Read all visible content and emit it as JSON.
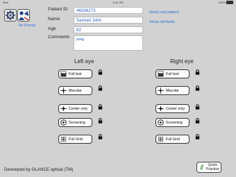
{
  "status_bar": {
    "carrier": "iPad",
    "time": "6:32 PM",
    "battery": "100%"
  },
  "side": {
    "no_prompt_label": "No Prompt"
  },
  "patient": {
    "id_label": "Patient ID",
    "id_value": "46336273",
    "name_label": "Name",
    "name_value": "Samuel John",
    "age_label": "Age",
    "age_value": "82",
    "comments_label": "Comments",
    "comments_value": "poag"
  },
  "links": {
    "new_load": "New/Load patient",
    "show_old": "Show old fields"
  },
  "left_eye": {
    "heading": "Left eye",
    "tests": [
      {
        "label": "Full test",
        "icon": "full-test-icon"
      },
      {
        "label": "Macular",
        "icon": "macular-icon"
      },
      {
        "label": "Center only",
        "icon": "center-only-icon"
      },
      {
        "label": "Screening",
        "icon": "screening-icon"
      },
      {
        "label": "Full Grid",
        "icon": "full-grid-icon"
      }
    ]
  },
  "right_eye": {
    "heading": "Right eye",
    "tests": [
      {
        "label": "Full test",
        "icon": "full-test-icon"
      },
      {
        "label": "Macular",
        "icon": "macular-icon"
      },
      {
        "label": "Center only",
        "icon": "center-only-icon"
      },
      {
        "label": "Screening",
        "icon": "screening-icon"
      },
      {
        "label": "Full Grid",
        "icon": "full-grid-icon"
      }
    ]
  },
  "footer": {
    "developer": "Developed by GLANCE optical (TM)"
  },
  "quick_practise": {
    "line1": "Quick",
    "line2": "Practise"
  },
  "colors": {
    "background": "#d2d2d2",
    "link": "#2a6fd8",
    "field_text": "#2a5ab8"
  }
}
